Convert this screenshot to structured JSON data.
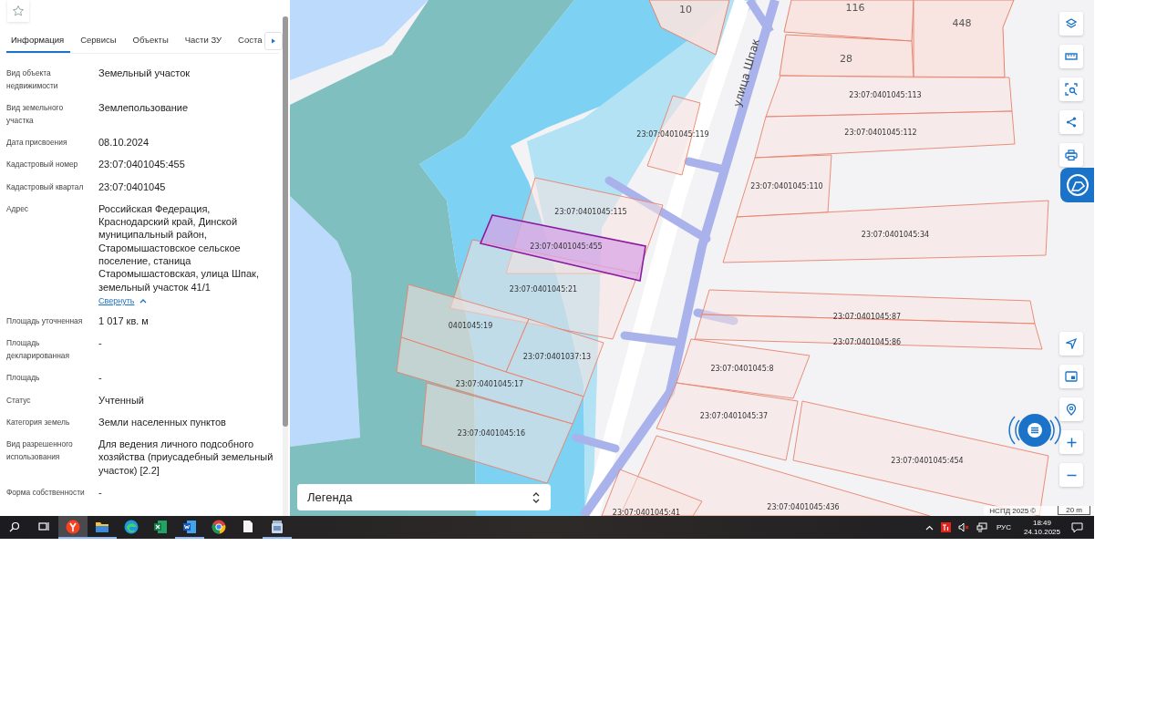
{
  "panel": {
    "tabs": [
      {
        "label": "Информация",
        "selected": true
      },
      {
        "label": "Сервисы",
        "selected": false
      },
      {
        "label": "Объекты",
        "selected": false
      },
      {
        "label": "Части ЗУ",
        "selected": false
      },
      {
        "label": "Соста",
        "selected": false
      }
    ],
    "fields": [
      {
        "label": "Вид объекта недвижимости",
        "value": "Земельный участок"
      },
      {
        "label": "Вид земельного участка",
        "value": "Землепользование"
      },
      {
        "label": "Дата присвоения",
        "value": "08.10.2024"
      },
      {
        "label": "Кадастровый номер",
        "value": "23:07:0401045:455"
      },
      {
        "label": "Кадастровый квартал",
        "value": "23:07:0401045"
      },
      {
        "label": "Адрес",
        "value": "Российская Федерация, Краснодарский край, Динской муниципальный район, Старомышастовское сельское поселение, станица Старомышастовская, улица Шпак, земельный участок 41/1",
        "toggle": "Свернуть"
      },
      {
        "label": "Площадь уточненная",
        "value": "1 017 кв. м"
      },
      {
        "label": "Площадь декларированная",
        "value": "-"
      },
      {
        "label": "Площадь",
        "value": "-"
      },
      {
        "label": "Статус",
        "value": "Учтенный"
      },
      {
        "label": "Категория земель",
        "value": "Земли населенных пунктов"
      },
      {
        "label": "Вид разрешенного использования",
        "value": "Для ведения личного подсобного хозяйства (приусадебный земельный участок) [2.2]"
      },
      {
        "label": "Форма собственности",
        "value": "-"
      }
    ]
  },
  "map": {
    "street": "улица Шпак",
    "house_numbers": [
      "10",
      "116",
      "448",
      "28"
    ],
    "parcels": [
      {
        "label": "23:07:0401045:115",
        "selected": false
      },
      {
        "label": "23:07:0401045:21",
        "selected": false
      },
      {
        "label": "0401045:19",
        "selected": false
      },
      {
        "label": "23:07:0401037:13",
        "selected": false
      },
      {
        "label": "23:07:0401045:17",
        "selected": false
      },
      {
        "label": "23:07:0401045:16",
        "selected": false
      },
      {
        "label": "23:07:0401045:119",
        "selected": false
      },
      {
        "label": "23:07:0401045:113",
        "selected": false
      },
      {
        "label": "23:07:0401045:112",
        "selected": false
      },
      {
        "label": "23:07:0401045:110",
        "selected": false
      },
      {
        "label": "23:07:0401045:34",
        "selected": false
      },
      {
        "label": "23:07:0401045:87",
        "selected": false
      },
      {
        "label": "23:07:0401045:86",
        "selected": false
      },
      {
        "label": "23:07:0401045:8",
        "selected": false
      },
      {
        "label": "23:07:0401045:37",
        "selected": false
      },
      {
        "label": "23:07:0401045:454",
        "selected": false
      },
      {
        "label": "23:07:0401045:436",
        "selected": false
      },
      {
        "label": "23:07:0401045:41",
        "selected": false
      },
      {
        "label": "23:07:0401045:455",
        "selected": true
      }
    ],
    "legend": "Легенда",
    "attribution": "НСПД 2025 ©",
    "scale": "20 m"
  },
  "taskbar": {
    "language": "РУС",
    "time": "18:49",
    "date": "24.10.2025"
  }
}
